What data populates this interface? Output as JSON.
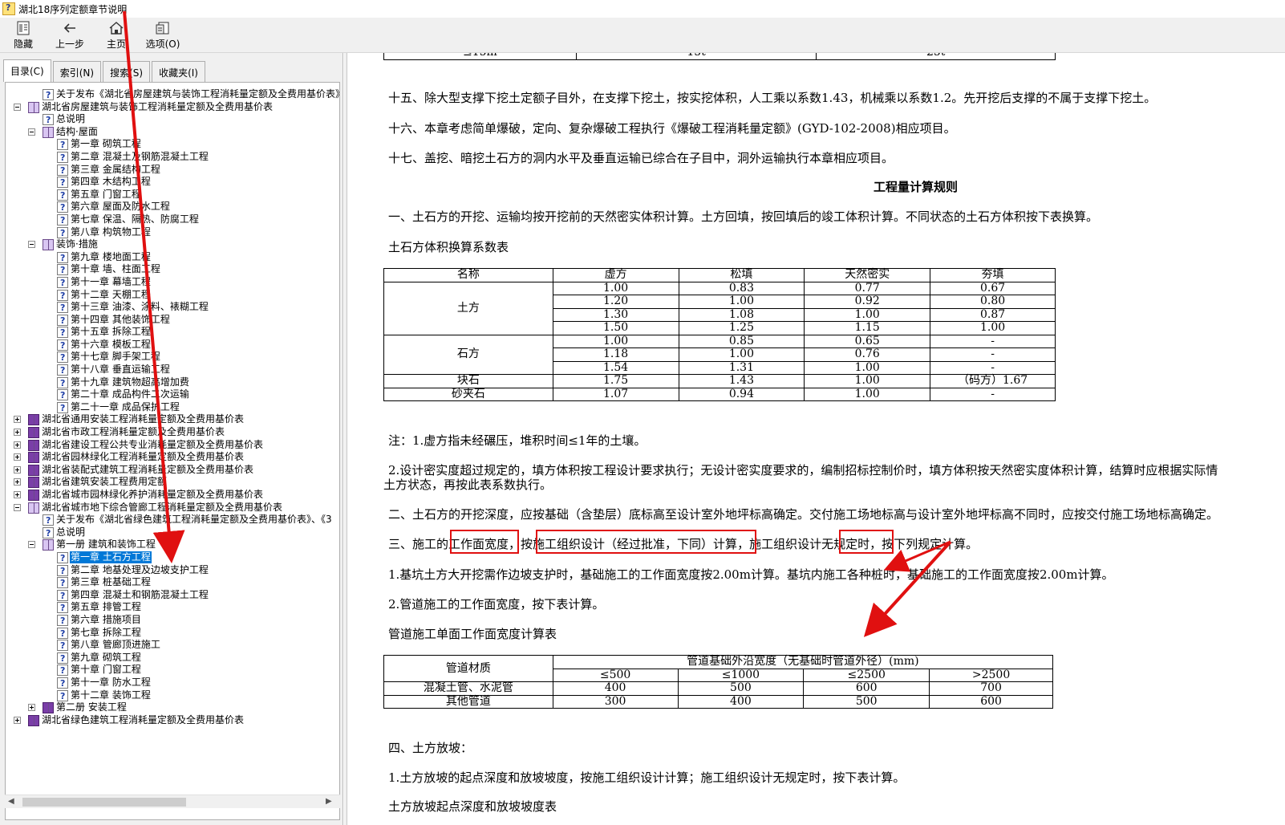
{
  "window": {
    "title": "湖北18序列定额章节说明"
  },
  "toolbar": [
    {
      "label": "隐藏",
      "icon": "hide-icon"
    },
    {
      "label": "上一步",
      "icon": "back-arrow-icon"
    },
    {
      "label": "主页",
      "icon": "home-icon"
    },
    {
      "label": "选项(O)",
      "icon": "options-icon"
    }
  ],
  "tabs": [
    "目录(C)",
    "索引(N)",
    "搜索(S)",
    "收藏夹(I)"
  ],
  "tree": [
    {
      "level": 2,
      "icon": "help",
      "text": "关于发布《湖北省房屋建筑与装饰工程消耗量定额及全费用基价表》等"
    },
    {
      "level": 1,
      "icon": "book",
      "toggle": "minus",
      "text": "湖北省房屋建筑与装饰工程消耗量定额及全费用基价表"
    },
    {
      "level": 2,
      "icon": "help",
      "text": "总说明"
    },
    {
      "level": 2,
      "icon": "book",
      "toggle": "minus",
      "text": "结构·屋面"
    },
    {
      "level": 3,
      "icon": "help",
      "text": "第一章 砌筑工程"
    },
    {
      "level": 3,
      "icon": "help",
      "text": "第二章 混凝土及钢筋混凝土工程"
    },
    {
      "level": 3,
      "icon": "help",
      "text": "第三章 金属结构工程"
    },
    {
      "level": 3,
      "icon": "help",
      "text": "第四章 木结构工程"
    },
    {
      "level": 3,
      "icon": "help",
      "text": "第五章 门窗工程"
    },
    {
      "level": 3,
      "icon": "help",
      "text": "第六章 屋面及防水工程"
    },
    {
      "level": 3,
      "icon": "help",
      "text": "第七章 保温、隔热、防腐工程"
    },
    {
      "level": 3,
      "icon": "help",
      "text": "第八章 构筑物工程"
    },
    {
      "level": 2,
      "icon": "book",
      "toggle": "minus",
      "text": "装饰·措施"
    },
    {
      "level": 3,
      "icon": "help",
      "text": "第九章 楼地面工程"
    },
    {
      "level": 3,
      "icon": "help",
      "text": "第十章 墙、柱面工程"
    },
    {
      "level": 3,
      "icon": "help",
      "text": "第十一章 幕墙工程"
    },
    {
      "level": 3,
      "icon": "help",
      "text": "第十二章 天棚工程"
    },
    {
      "level": 3,
      "icon": "help",
      "text": "第十三章 油漆、涂料、裱糊工程"
    },
    {
      "level": 3,
      "icon": "help",
      "text": "第十四章 其他装饰工程"
    },
    {
      "level": 3,
      "icon": "help",
      "text": "第十五章 拆除工程"
    },
    {
      "level": 3,
      "icon": "help",
      "text": "第十六章 模板工程"
    },
    {
      "level": 3,
      "icon": "help",
      "text": "第十七章 脚手架工程"
    },
    {
      "level": 3,
      "icon": "help",
      "text": "第十八章 垂直运输工程"
    },
    {
      "level": 3,
      "icon": "help",
      "text": "第十九章 建筑物超高增加费"
    },
    {
      "level": 3,
      "icon": "help",
      "text": "第二十章 成品构件二次运输"
    },
    {
      "level": 3,
      "icon": "help",
      "text": "第二十一章 成品保护工程"
    },
    {
      "level": 1,
      "icon": "book-closed",
      "toggle": "plus",
      "text": "湖北省通用安装工程消耗量定额及全费用基价表"
    },
    {
      "level": 1,
      "icon": "book-closed",
      "toggle": "plus",
      "text": "湖北省市政工程消耗量定额及全费用基价表"
    },
    {
      "level": 1,
      "icon": "book-closed",
      "toggle": "plus",
      "text": "湖北省建设工程公共专业消耗量定额及全费用基价表"
    },
    {
      "level": 1,
      "icon": "book-closed",
      "toggle": "plus",
      "text": "湖北省园林绿化工程消耗量定额及全费用基价表"
    },
    {
      "level": 1,
      "icon": "book-closed",
      "toggle": "plus",
      "text": "湖北省装配式建筑工程消耗量定额及全费用基价表"
    },
    {
      "level": 1,
      "icon": "book-closed",
      "toggle": "plus",
      "text": "湖北省建筑安装工程费用定额"
    },
    {
      "level": 1,
      "icon": "book-closed",
      "toggle": "plus",
      "text": "湖北省城市园林绿化养护消耗量定额及全费用基价表"
    },
    {
      "level": 1,
      "icon": "book",
      "toggle": "minus",
      "text": "湖北省城市地下综合管廊工程消耗量定额及全费用基价表"
    },
    {
      "level": 2,
      "icon": "help",
      "text": "关于发布《湖北省绿色建筑工程消耗量定额及全费用基价表》、《3"
    },
    {
      "level": 2,
      "icon": "help",
      "text": "总说明"
    },
    {
      "level": 2,
      "icon": "book",
      "toggle": "minus",
      "text": "第一册 建筑和装饰工程"
    },
    {
      "level": 3,
      "icon": "help",
      "text": "第一章 土石方工程",
      "selected": true
    },
    {
      "level": 3,
      "icon": "help",
      "text": "第二章 地基处理及边坡支护工程"
    },
    {
      "level": 3,
      "icon": "help",
      "text": "第三章 桩基础工程"
    },
    {
      "level": 3,
      "icon": "help",
      "text": "第四章 混凝土和钢筋混凝土工程"
    },
    {
      "level": 3,
      "icon": "help",
      "text": "第五章 排管工程"
    },
    {
      "level": 3,
      "icon": "help",
      "text": "第六章 措施项目"
    },
    {
      "level": 3,
      "icon": "help",
      "text": "第七章 拆除工程"
    },
    {
      "level": 3,
      "icon": "help",
      "text": "第八章 管廊顶进施工"
    },
    {
      "level": 3,
      "icon": "help",
      "text": "第九章 砌筑工程"
    },
    {
      "level": 3,
      "icon": "help",
      "text": "第十章 门窗工程"
    },
    {
      "level": 3,
      "icon": "help",
      "text": "第十一章 防水工程"
    },
    {
      "level": 3,
      "icon": "help",
      "text": "第十二章 装饰工程"
    },
    {
      "level": 2,
      "icon": "book-closed",
      "toggle": "plus",
      "text": "第二册 安装工程"
    },
    {
      "level": 1,
      "icon": "book-closed",
      "toggle": "plus",
      "text": "湖北省绿色建筑工程消耗量定额及全费用基价表"
    }
  ],
  "content": {
    "top_table_row": [
      "≤15m",
      "15t",
      "25t"
    ],
    "para15": "十五、除大型支撑下挖土定额子目外，在支撑下挖土，按实挖体积，人工乘以系数1.43，机械乘以系数1.2。先开挖后支撑的不属于支撑下挖土。",
    "para16": "十六、本章考虑简单爆破，定向、复杂爆破工程执行《爆破工程消耗量定额》(GYD-102-2008)相应项目。",
    "para17": "十七、盖挖、暗挖土石方的洞内水平及垂直运输已综合在子目中，洞外运输执行本章相应项目。",
    "rules_heading": "工程量计算规则",
    "rule1": "一、土石方的开挖、运输均按开挖前的天然密实体积计算。土方回填，按回填后的竣工体积计算。不同状态的土石方体积按下表换算。",
    "table1_title": "土石方体积换算系数表",
    "table1": {
      "headers": [
        "名称",
        "虚方",
        "松填",
        "天然密实",
        "夯填"
      ],
      "groups": [
        {
          "name": "土方",
          "rows": [
            [
              "1.00",
              "0.83",
              "0.77",
              "0.67"
            ],
            [
              "1.20",
              "1.00",
              "0.92",
              "0.80"
            ],
            [
              "1.30",
              "1.08",
              "1.00",
              "0.87"
            ],
            [
              "1.50",
              "1.25",
              "1.15",
              "1.00"
            ]
          ]
        },
        {
          "name": "石方",
          "rows": [
            [
              "1.00",
              "0.85",
              "0.65",
              "-"
            ],
            [
              "1.18",
              "1.00",
              "0.76",
              "-"
            ],
            [
              "1.54",
              "1.31",
              "1.00",
              "-"
            ]
          ]
        },
        {
          "name": "块石",
          "rows": [
            [
              "1.75",
              "1.43",
              "1.00",
              "（码方）1.67"
            ]
          ]
        },
        {
          "name": "砂夹石",
          "rows": [
            [
              "1.07",
              "0.94",
              "1.00",
              "-"
            ]
          ]
        }
      ]
    },
    "note1": "注：1.虚方指未经碾压，堆积时间≤1年的土壤。",
    "note2a": "2.设计密实度超过规定的，填方体积按工程设计要求执行；无设计密实度要求的，编制招标控制价时，填方体积按天然密实度体积计算，结算时应根据实际情",
    "note2b": "土方状态，再按此表系数执行。",
    "rule2": "二、土石方的开挖深度，应按基础（含垫层）底标高至设计室外地坪标高确定。交付施工场地标高与设计室外地坪标高不同时，应按交付施工场地标高确定。",
    "rule3": {
      "p1": "三、施工的",
      "p2": "工作面宽度",
      "p3": "，按",
      "p4": "施工组织设计（经过批准，下同）计算",
      "p5": "，施工组织设计",
      "p6": "无规定时",
      "p7": "，按下列规定计算。"
    },
    "rule3_1": "1.基坑土方大开挖需作边坡支护时，基础施工的工作面宽度按2.00m计算。基坑内施工各种桩时，基础施工的工作面宽度按2.00m计算。",
    "rule3_2": "2.管道施工的工作面宽度，按下表计算。",
    "table2_title": "管道施工单面工作面宽度计算表",
    "table2": {
      "col0": "管道材质",
      "group_header": "管道基础外沿宽度（无基础时管道外径）(mm)",
      "sub_headers": [
        "≤500",
        "≤1000",
        "≤2500",
        ">2500"
      ],
      "rows": [
        {
          "name": "混凝土管、水泥管",
          "values": [
            "400",
            "500",
            "600",
            "700"
          ]
        },
        {
          "name": "其他管道",
          "values": [
            "300",
            "400",
            "500",
            "600"
          ]
        }
      ]
    },
    "rule4": "四、土方放坡：",
    "rule4_1": "1.土方放坡的起点深度和放坡坡度，按施工组织设计计算；施工组织设计无规定时，按下表计算。",
    "table3_title": "土方放坡起点深度和放坡坡度表"
  },
  "colors": {
    "selection": "#0078d7",
    "annotation": "#e01010"
  }
}
